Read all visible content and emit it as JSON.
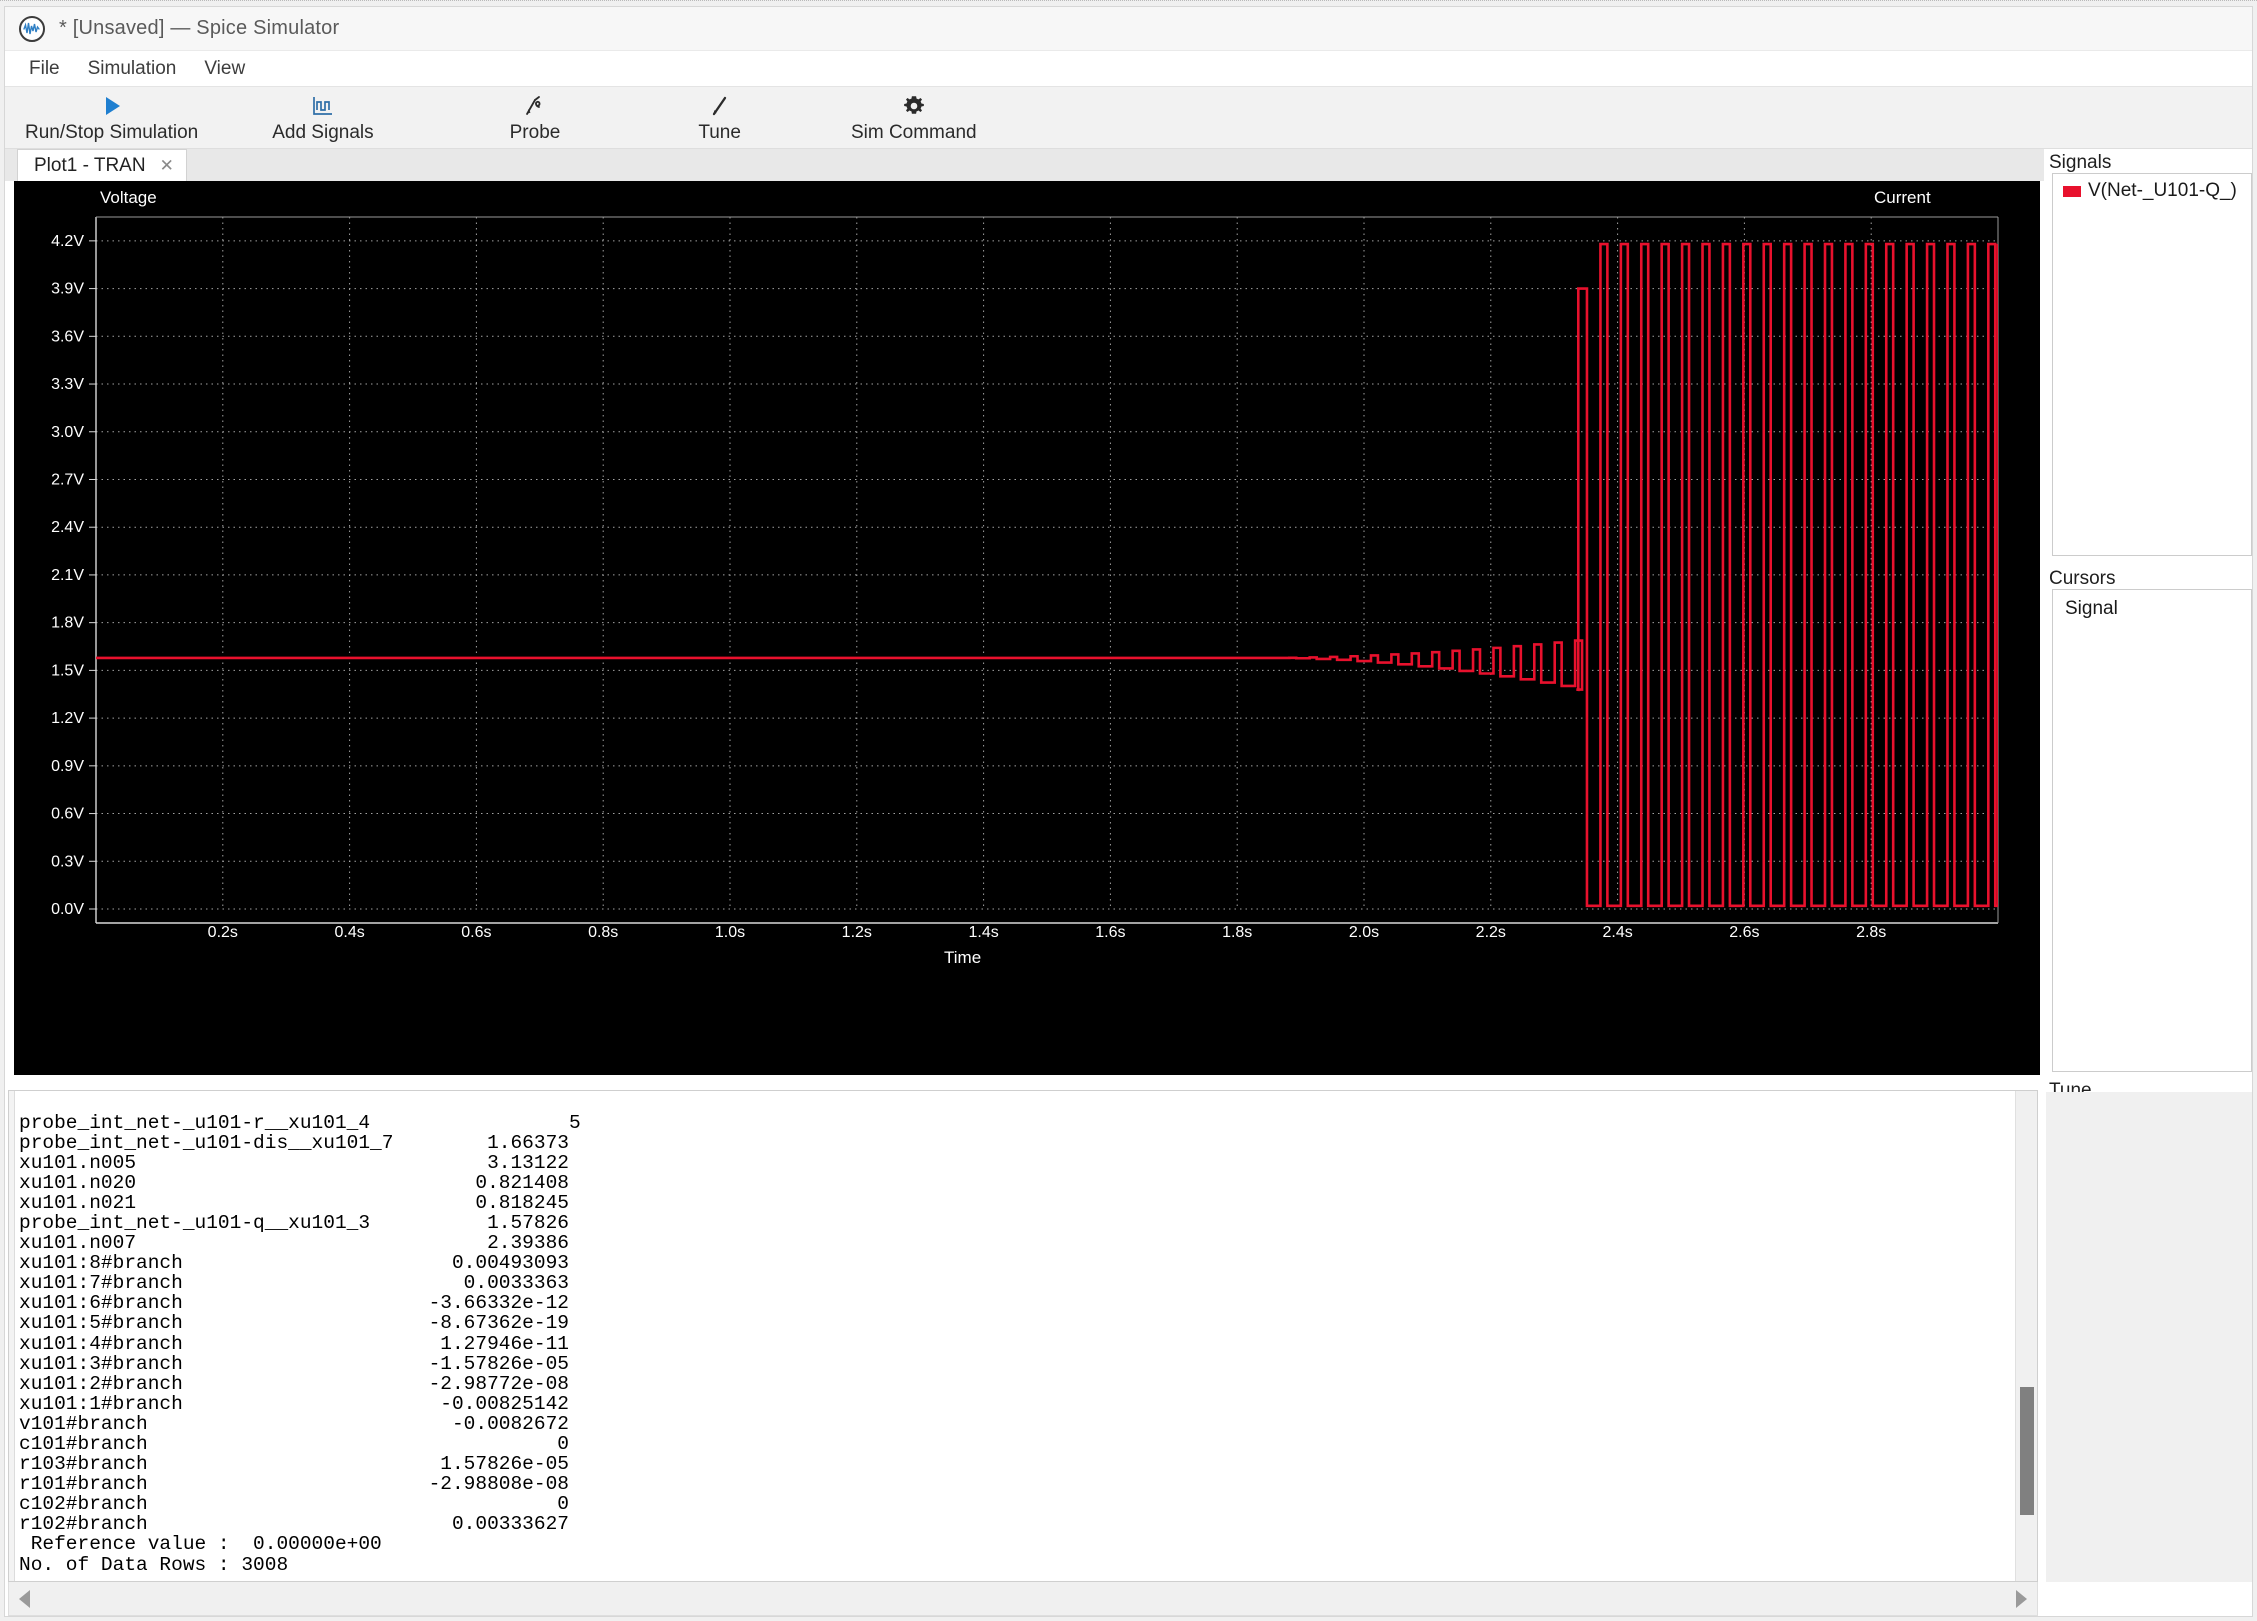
{
  "window": {
    "title": "* [Unsaved] — Spice Simulator",
    "logo_icon": "waveform-circle-icon"
  },
  "menu": {
    "items": [
      {
        "label": "File"
      },
      {
        "label": "Simulation"
      },
      {
        "label": "View"
      }
    ]
  },
  "toolbar": {
    "buttons": [
      {
        "label": "Run/Stop Simulation",
        "icon": "play-triangle-icon"
      },
      {
        "label": "Add Signals",
        "icon": "waveform-axes-icon"
      },
      {
        "label": "Probe",
        "icon": "probe-pen-icon"
      },
      {
        "label": "Tune",
        "icon": "screwdriver-icon"
      },
      {
        "label": "Sim Command",
        "icon": "gear-icon"
      }
    ]
  },
  "tabs": [
    {
      "label": "Plot1 - TRAN",
      "close_glyph": "✕",
      "active": true
    }
  ],
  "panels": {
    "signals": {
      "title": "Signals",
      "items": [
        {
          "name": "V(Net-_U101-Q_)",
          "color": "#e8112d"
        }
      ]
    },
    "cursors": {
      "title": "Cursors",
      "column_header": "Signal",
      "rows": []
    },
    "tune": {
      "title": "Tune"
    }
  },
  "log": {
    "lines": [
      "probe_int_net-_u101-r__xu101_4                 5",
      "probe_int_net-_u101-dis__xu101_7        1.66373",
      "xu101.n005                              3.13122",
      "xu101.n020                             0.821408",
      "xu101.n021                             0.818245",
      "probe_int_net-_u101-q__xu101_3          1.57826",
      "xu101.n007                              2.39386",
      "xu101:8#branch                       0.00493093",
      "xu101:7#branch                        0.0033363",
      "xu101:6#branch                     -3.66332e-12",
      "xu101:5#branch                     -8.67362e-19",
      "xu101:4#branch                      1.27946e-11",
      "xu101:3#branch                     -1.57826e-05",
      "xu101:2#branch                     -2.98772e-08",
      "xu101:1#branch                      -0.00825142",
      "v101#branch                          -0.0082672",
      "c101#branch                                   0",
      "r103#branch                         1.57826e-05",
      "r101#branch                        -2.98808e-08",
      "c102#branch                                   0",
      "r102#branch                          0.00333627",
      " Reference value :  0.00000e+00",
      "No. of Data Rows : 3008"
    ]
  },
  "chart_data": {
    "type": "line",
    "title": "",
    "left_axis_label": "Voltage",
    "right_axis_label": "Current",
    "xlabel": "Time",
    "ylabel": "Voltage",
    "background": "#000000",
    "grid": true,
    "grid_color": "#bfbfbf",
    "axis_color": "#d9d9d9",
    "trace_color": "#e8112d",
    "xlim": [
      0.0,
      3.0
    ],
    "ylim": [
      0.0,
      4.35
    ],
    "xticks": [
      "0.2s",
      "0.4s",
      "0.6s",
      "0.8s",
      "1.0s",
      "1.2s",
      "1.4s",
      "1.6s",
      "1.8s",
      "2.0s",
      "2.2s",
      "2.4s",
      "2.6s",
      "2.8s"
    ],
    "xtick_values": [
      0.2,
      0.4,
      0.6,
      0.8,
      1.0,
      1.2,
      1.4,
      1.6,
      1.8,
      2.0,
      2.2,
      2.4,
      2.6,
      2.8
    ],
    "yticks": [
      "0.0V",
      "0.3V",
      "0.6V",
      "0.9V",
      "1.2V",
      "1.5V",
      "1.8V",
      "2.1V",
      "2.4V",
      "2.7V",
      "3.0V",
      "3.3V",
      "3.6V",
      "3.9V",
      "4.2V"
    ],
    "ytick_values": [
      0.0,
      0.3,
      0.6,
      0.9,
      1.2,
      1.5,
      1.8,
      2.1,
      2.4,
      2.7,
      3.0,
      3.3,
      3.6,
      3.9,
      4.2
    ],
    "series": [
      {
        "name": "V(Net-_U101-Q_)",
        "color": "#e8112d",
        "description": "Quiescent DC level at 1.578 V from 0 s, with a slowly growing oscillation ripple starting near 1.85 s, then relaxation-oscillator square wave switching from 2.34 s to 3.0 s",
        "dc_level": 1.578,
        "ripple_start_time": 1.85,
        "ripple_end_time": 2.335,
        "ripple_max_halfamplitude": 0.2,
        "oscillation_start_time": 2.338,
        "first_pulse_peak": 3.9,
        "pulse_high": 4.18,
        "pulse_low": 0.02,
        "pulse_period": 0.0322,
        "pulse_duty": 0.34
      }
    ]
  }
}
